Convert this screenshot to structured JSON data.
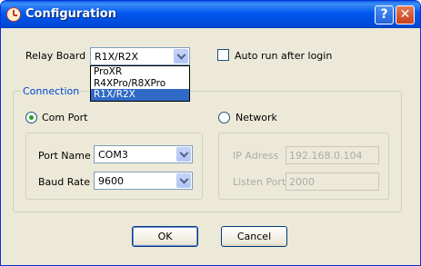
{
  "window": {
    "title": "Configuration",
    "help_label": "?",
    "close_label": "✕"
  },
  "relay": {
    "label": "Relay Board",
    "value": "R1X/R2X",
    "options": [
      "ProXR",
      "R4XPro/R8XPro",
      "R1X/R2X"
    ],
    "selected_index": 2
  },
  "autorun": {
    "label": "Auto run after login",
    "checked": false
  },
  "connection": {
    "group_label": "Connection",
    "com_port": {
      "label": "Com Port",
      "checked": true,
      "port_name_label": "Port Name",
      "port_name_value": "COM3",
      "baud_rate_label": "Baud Rate",
      "baud_rate_value": "9600"
    },
    "network": {
      "label": "Network",
      "checked": false,
      "ip_label": "IP Adress",
      "ip_value": "192.168.0.104",
      "listen_label": "Listen Port",
      "listen_value": "2000"
    }
  },
  "buttons": {
    "ok": "OK",
    "cancel": "Cancel"
  }
}
